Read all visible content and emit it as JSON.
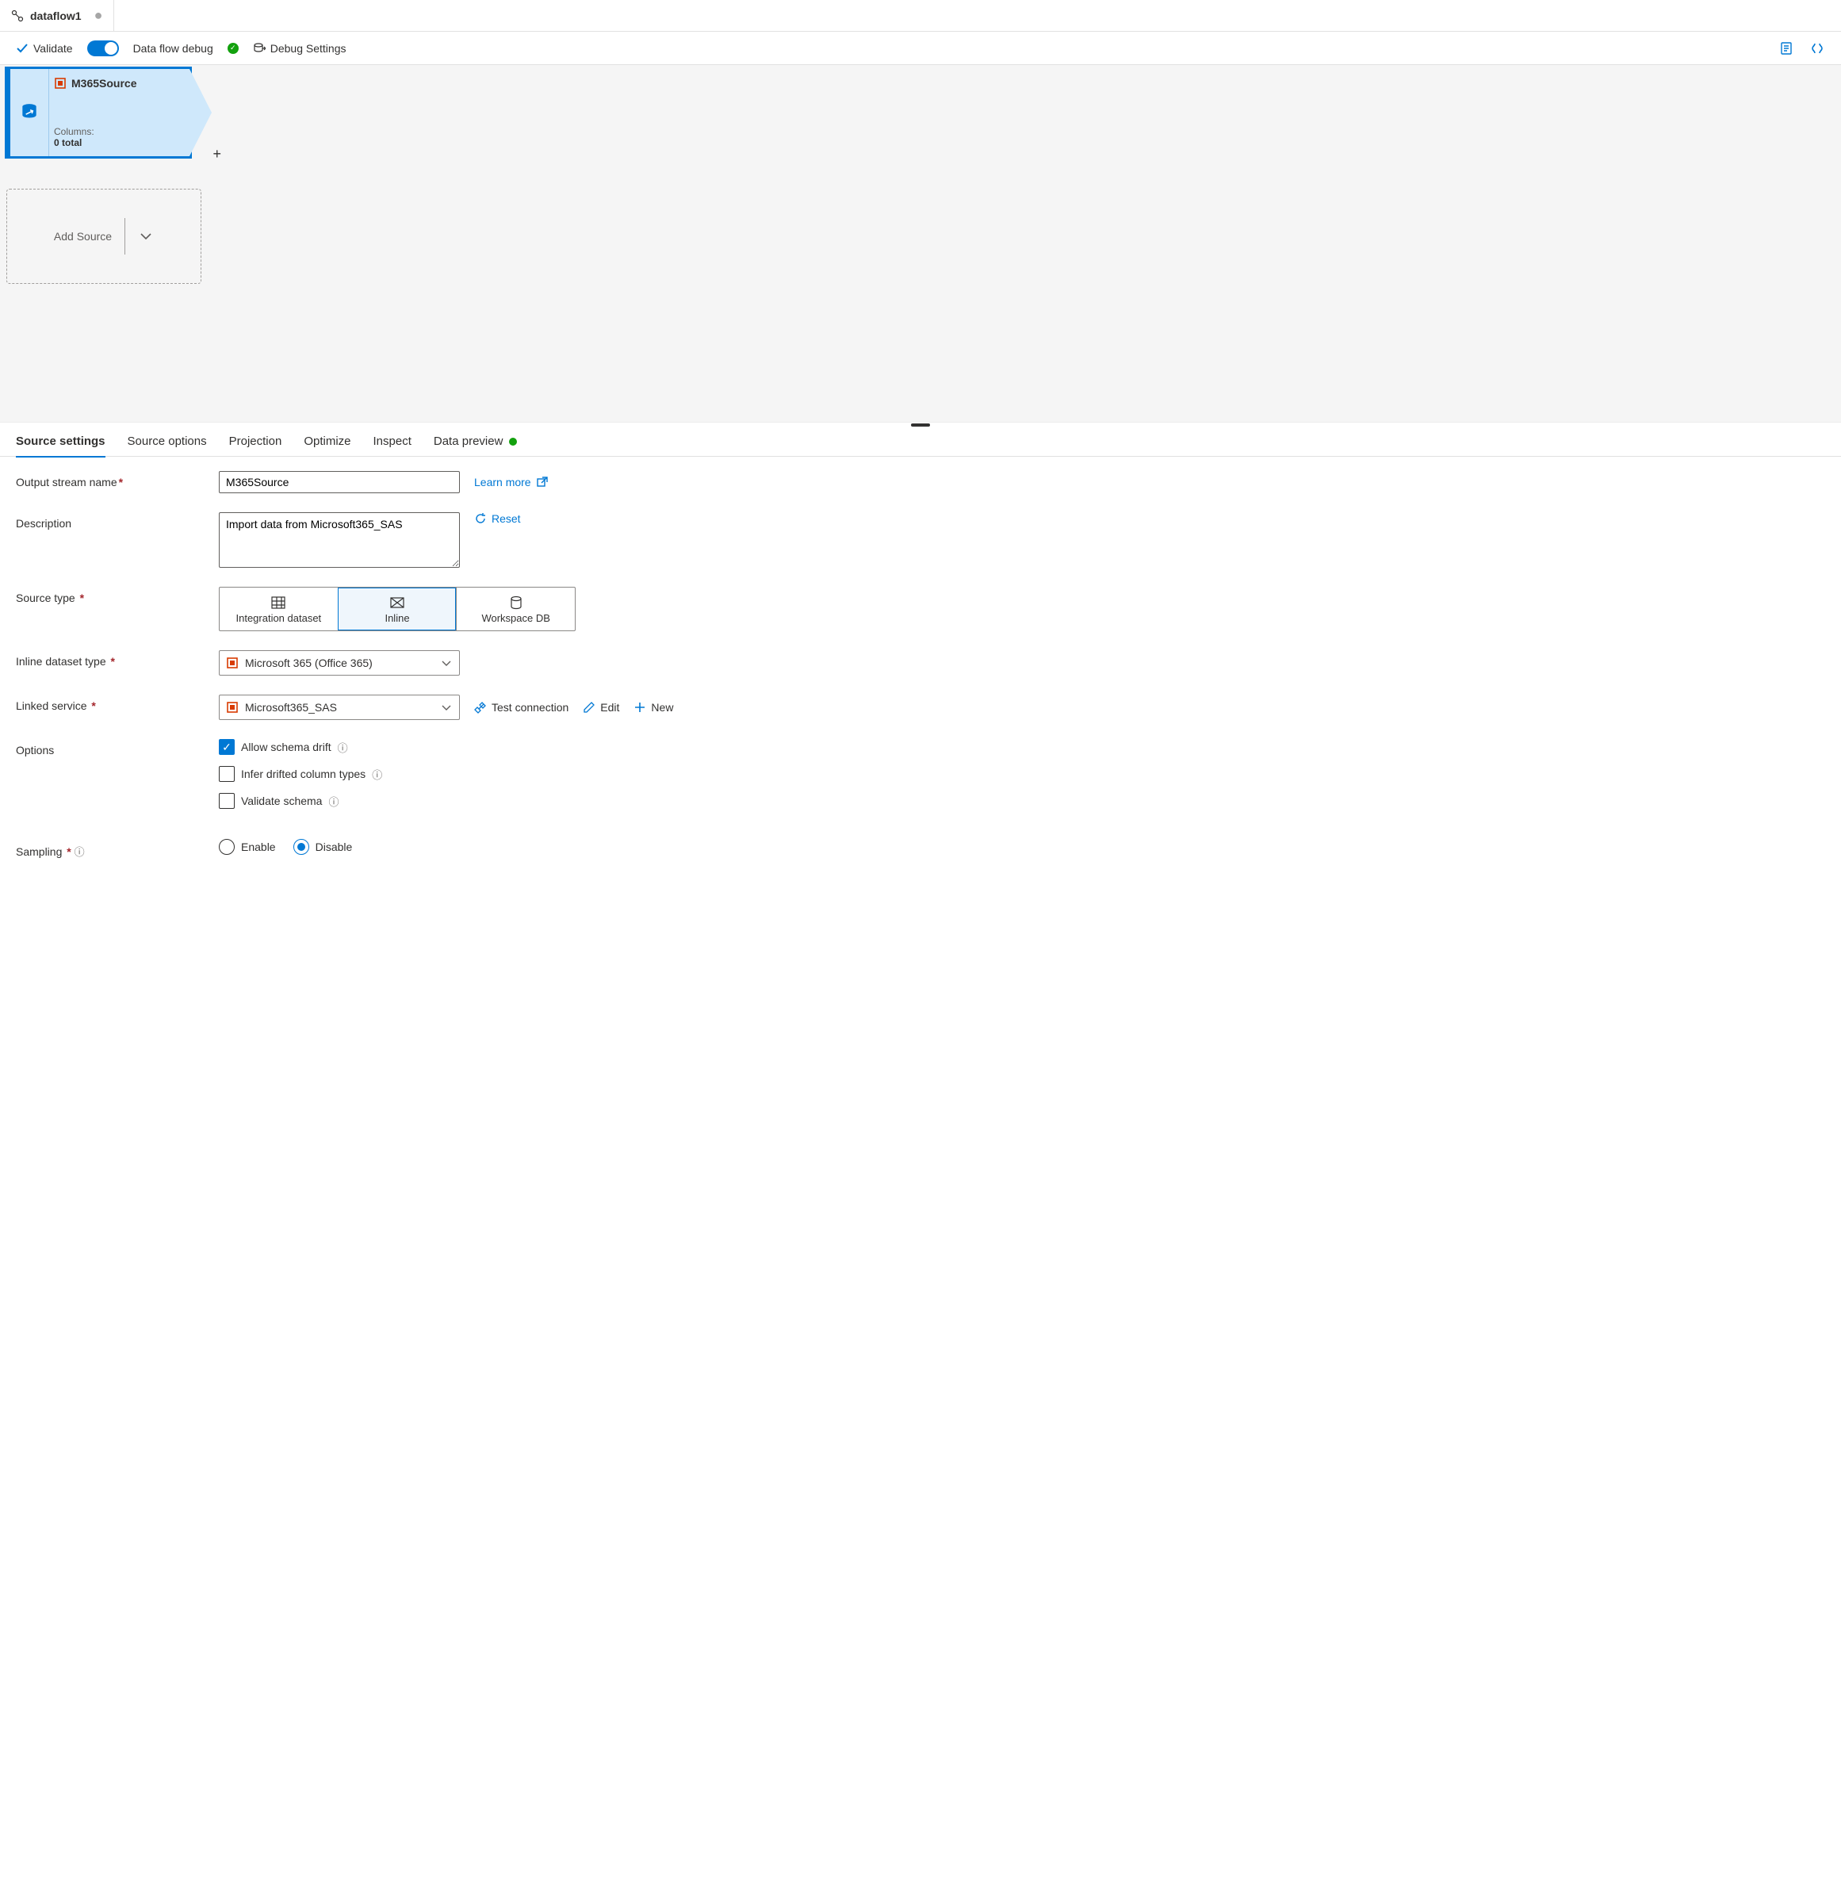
{
  "tab": {
    "title": "dataflow1"
  },
  "toolbar": {
    "validate": "Validate",
    "debug_label": "Data flow debug",
    "debug_on": true,
    "debug_settings": "Debug Settings"
  },
  "node": {
    "title": "M365Source",
    "columns_label": "Columns:",
    "columns_count": "0 total"
  },
  "add_source_label": "Add Source",
  "panel_tabs": {
    "source_settings": "Source settings",
    "source_options": "Source options",
    "projection": "Projection",
    "optimize": "Optimize",
    "inspect": "Inspect",
    "data_preview": "Data preview"
  },
  "form": {
    "output_stream_name": {
      "label": "Output stream name",
      "value": "M365Source"
    },
    "learn_more": "Learn more",
    "description": {
      "label": "Description",
      "value": "Import data from Microsoft365_SAS"
    },
    "reset": "Reset",
    "source_type": {
      "label": "Source type",
      "options": {
        "integration_dataset": "Integration dataset",
        "inline": "Inline",
        "workspace_db": "Workspace DB"
      },
      "selected": "inline"
    },
    "inline_dataset_type": {
      "label": "Inline dataset type",
      "value": "Microsoft 365 (Office 365)"
    },
    "linked_service": {
      "label": "Linked service",
      "value": "Microsoft365_SAS"
    },
    "test_connection": "Test connection",
    "edit": "Edit",
    "new": "New",
    "options": {
      "label": "Options",
      "allow_schema_drift": "Allow schema drift",
      "infer_drifted": "Infer drifted column types",
      "validate_schema": "Validate schema"
    },
    "sampling": {
      "label": "Sampling",
      "enable": "Enable",
      "disable": "Disable",
      "selected": "disable"
    }
  }
}
